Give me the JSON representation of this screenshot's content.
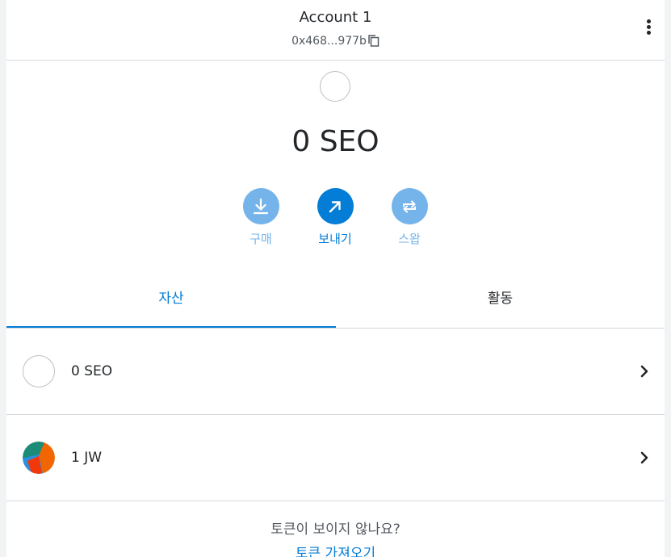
{
  "header": {
    "account_name": "Account 1",
    "address_short": "0x468...977b"
  },
  "balance": {
    "display": "0 SEO"
  },
  "actions": [
    {
      "label": "구매",
      "icon": "download-icon",
      "enabled": false
    },
    {
      "label": "보내기",
      "icon": "arrow-up-right-icon",
      "enabled": true
    },
    {
      "label": "스왑",
      "icon": "swap-icon",
      "enabled": false
    }
  ],
  "tabs": [
    {
      "label": "자산",
      "active": true
    },
    {
      "label": "활동",
      "active": false
    }
  ],
  "assets": [
    {
      "label": "0 SEO",
      "icon": "empty-token-icon"
    },
    {
      "label": "1 JW",
      "icon": "jazzicon"
    }
  ],
  "footer": {
    "question": "토큰이 보이지 않나요?",
    "link": "토큰 가져오기"
  },
  "colors": {
    "primary": "#037dd6",
    "primary_disabled": "#75b4ea",
    "text": "#24272a",
    "muted": "#535a61",
    "border": "#d6d9dc"
  }
}
